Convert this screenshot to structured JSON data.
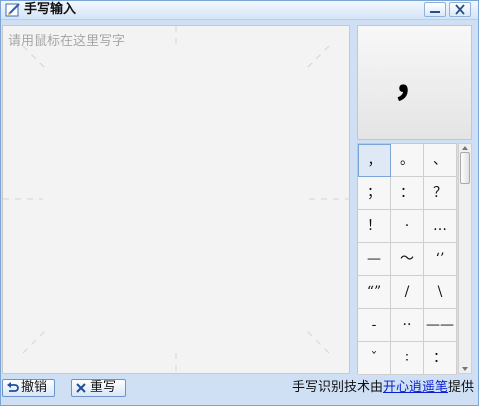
{
  "window": {
    "title": "手写输入"
  },
  "pad": {
    "hint": "请用鼠标在这里写字"
  },
  "preview": {
    "char": "，"
  },
  "candidates": [
    "，",
    "。",
    "、",
    "；",
    "：",
    "？",
    "！",
    "·",
    "…",
    "—",
    "～",
    "‘’",
    "“”",
    "/",
    "\\",
    "-",
    "··",
    "——",
    "ˇ",
    "∶",
    "："
  ],
  "selected_index": 0,
  "toolbar": {
    "undo_label": "撤销",
    "rewrite_label": "重写"
  },
  "credit": {
    "prefix": "手写识别技术由",
    "link": "开心逍遥笔",
    "suffix": "提供"
  },
  "colors": {
    "link": "#0a1fd0",
    "accent": "#7aa5d6",
    "pad_background": "#f3f3f3"
  },
  "icons": {
    "app": "pen-pad-icon",
    "minimize": "minimize-icon",
    "close": "close-icon",
    "undo": "undo-arrow-icon",
    "rewrite": "x-icon"
  }
}
